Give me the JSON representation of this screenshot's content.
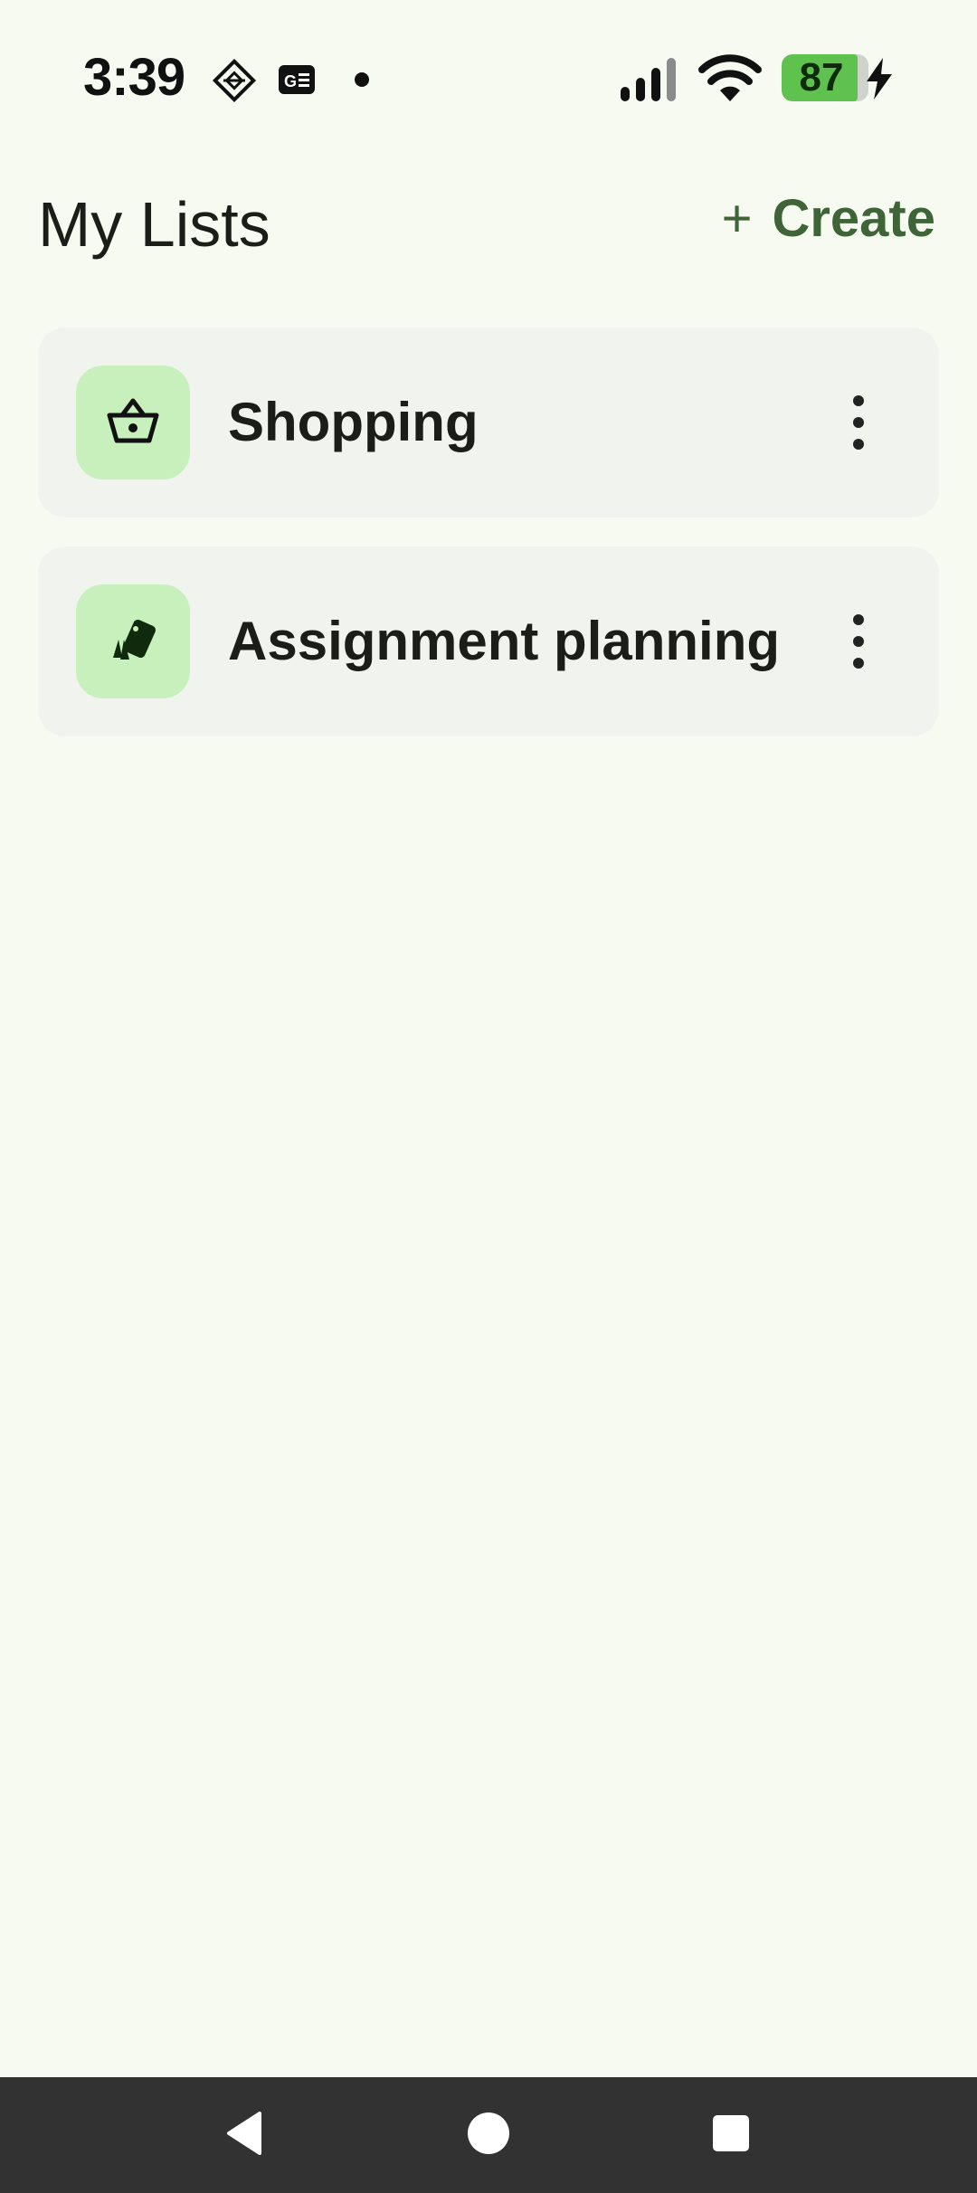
{
  "status_bar": {
    "time": "3:39",
    "battery_level": "87",
    "battery_fraction": 0.87,
    "icons": [
      "app-diamond-icon",
      "news-card-icon",
      "notification-dot-icon",
      "cell-signal-icon",
      "wifi-icon",
      "battery-icon",
      "charging-bolt-icon"
    ]
  },
  "header": {
    "title": "My Lists",
    "create_label": "Create",
    "create_icon": "plus-icon",
    "accent_color": "#3f6437"
  },
  "lists": [
    {
      "label": "Shopping",
      "icon": "basket-icon"
    },
    {
      "label": "Assignment planning",
      "icon": "cards-icon"
    }
  ],
  "nav_bar": {
    "back_icon": "back-triangle-icon",
    "home_icon": "home-circle-icon",
    "recents_icon": "recents-square-icon"
  }
}
